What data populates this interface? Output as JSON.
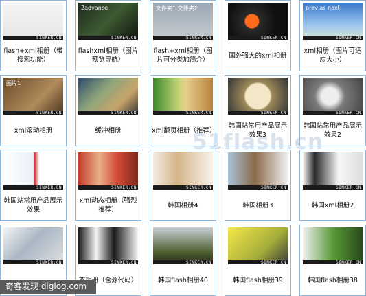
{
  "watermark": "51flash.cn",
  "thumb_watermark": "SINKER.CN",
  "credit": "奇客发现 diglog.com",
  "items": [
    {
      "caption": "flash+xml相册（带搜索功能）",
      "thumb": "white"
    },
    {
      "caption": "flashxml相册（图片预览导航）",
      "thumb": "dark",
      "overlay": "2advance"
    },
    {
      "caption": "flash+xml相册（图片可分类加简介）",
      "thumb": "gray",
      "overlay": "文件夹1 文件夹2"
    },
    {
      "caption": "国外强大的xml相册",
      "thumb": "dark-orange"
    },
    {
      "caption": "xml相册（图片可适应大小）",
      "thumb": "sky",
      "overlay": "prev as next"
    },
    {
      "caption": "xml滚动相册",
      "thumb": "brown",
      "overlay": "图片1"
    },
    {
      "caption": "缓冲相册",
      "thumb": "collage"
    },
    {
      "caption": "xml翻页相册（推荐）",
      "thumb": "book"
    },
    {
      "caption": "韩国站常用产品展示效果3",
      "thumb": "tower"
    },
    {
      "caption": "韩国站常用产品展示效果2",
      "thumb": "product-gray"
    },
    {
      "caption": "韩国站常用产品展示效果",
      "thumb": "product-white"
    },
    {
      "caption": "xml动态相册（强烈推荐）",
      "thumb": "people"
    },
    {
      "caption": "韩国相册4",
      "thumb": "interior"
    },
    {
      "caption": "韩国相册3",
      "thumb": "horse"
    },
    {
      "caption": "韩国xml相册2",
      "thumb": "keyboard"
    },
    {
      "caption": "",
      "thumb": "stack"
    },
    {
      "caption": "态相册（含源代码）",
      "thumb": "logos"
    },
    {
      "caption": "韩国flash相册40",
      "thumb": "grass"
    },
    {
      "caption": "韩国flash相册39",
      "thumb": "yellow"
    },
    {
      "caption": "韩国flash相册38",
      "thumb": "green-tree"
    }
  ],
  "colors": {
    "border": "#8fb6d8",
    "caption": "#111111"
  }
}
